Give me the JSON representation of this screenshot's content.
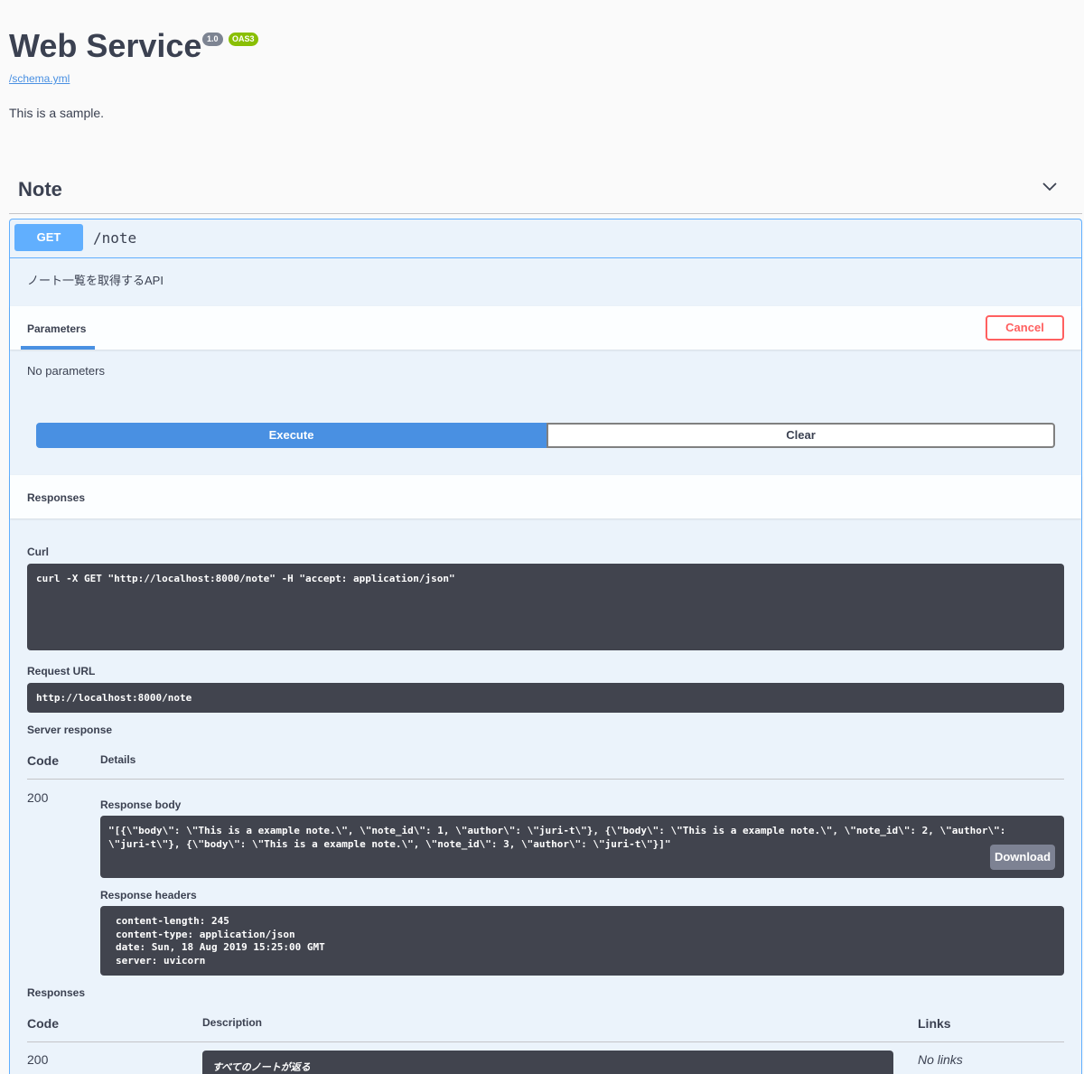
{
  "info": {
    "title": "Web Service",
    "version": "1.0",
    "oas": "OAS3",
    "schema_link": "/schema.yml",
    "description": "This is a sample."
  },
  "tag": {
    "name": "Note"
  },
  "operation": {
    "method": "GET",
    "path": "/note",
    "summary": "ノート一覧を取得するAPI",
    "parameters_tab": "Parameters",
    "cancel_label": "Cancel",
    "no_params": "No parameters",
    "execute_label": "Execute",
    "clear_label": "Clear",
    "responses_label": "Responses"
  },
  "live": {
    "curl_label": "Curl",
    "curl": "curl -X GET \"http://localhost:8000/note\" -H \"accept: application/json\"",
    "request_url_label": "Request URL",
    "request_url": "http://localhost:8000/note",
    "server_response_label": "Server response",
    "code_header": "Code",
    "details_header": "Details",
    "code": "200",
    "response_body_label": "Response body",
    "response_body_line1": "\"[{\\\"body\\\": \\\"This is a example note.\\\", \\\"note_id\\\": 1, \\\"author\\\": \\\"juri-t\\\"}, {\\\"body\\\": \\\"This is a example note.\\\", \\\"note_id\\\": 2, \\\"author\\\":",
    "response_body_line2": "\\\"juri-t\\\"}, {\\\"body\\\": \\\"This is a example note.\\\", \\\"note_id\\\": 3, \\\"author\\\": \\\"juri-t\\\"}]\"",
    "download_label": "Download",
    "response_headers_label": "Response headers",
    "response_headers": [
      "content-length: 245",
      "content-type: application/json",
      "date: Sun, 18 Aug 2019 15:25:00 GMT",
      "server: uvicorn"
    ]
  },
  "doc_responses": {
    "label": "Responses",
    "code_header": "Code",
    "description_header": "Description",
    "links_header": "Links",
    "rows": [
      {
        "code": "200",
        "description": "すべてのノートが返る",
        "links": "No links"
      }
    ]
  }
}
